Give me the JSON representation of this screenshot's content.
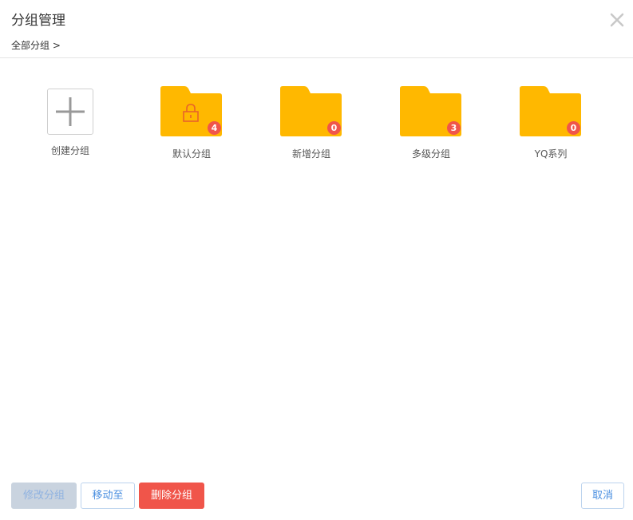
{
  "header": {
    "title": "分组管理",
    "close_icon": "close-icon"
  },
  "breadcrumb": {
    "text": "全部分组 >"
  },
  "create_group": {
    "label": "创建分组",
    "icon": "plus-icon"
  },
  "groups": [
    {
      "name": "默认分组",
      "count": "4",
      "locked": true
    },
    {
      "name": "新增分组",
      "count": "0",
      "locked": false
    },
    {
      "name": "多级分组",
      "count": "3",
      "locked": false
    },
    {
      "name": "YQ系列",
      "count": "0",
      "locked": false
    }
  ],
  "footer": {
    "edit_label": "修改分组",
    "move_label": "移动至",
    "delete_label": "删除分组",
    "cancel_label": "取消"
  },
  "colors": {
    "folder": "#FFB800",
    "badge": "#F0554A",
    "primary": "#4A8FE0",
    "danger": "#F0554A",
    "disabled": "#C9D3DF"
  }
}
